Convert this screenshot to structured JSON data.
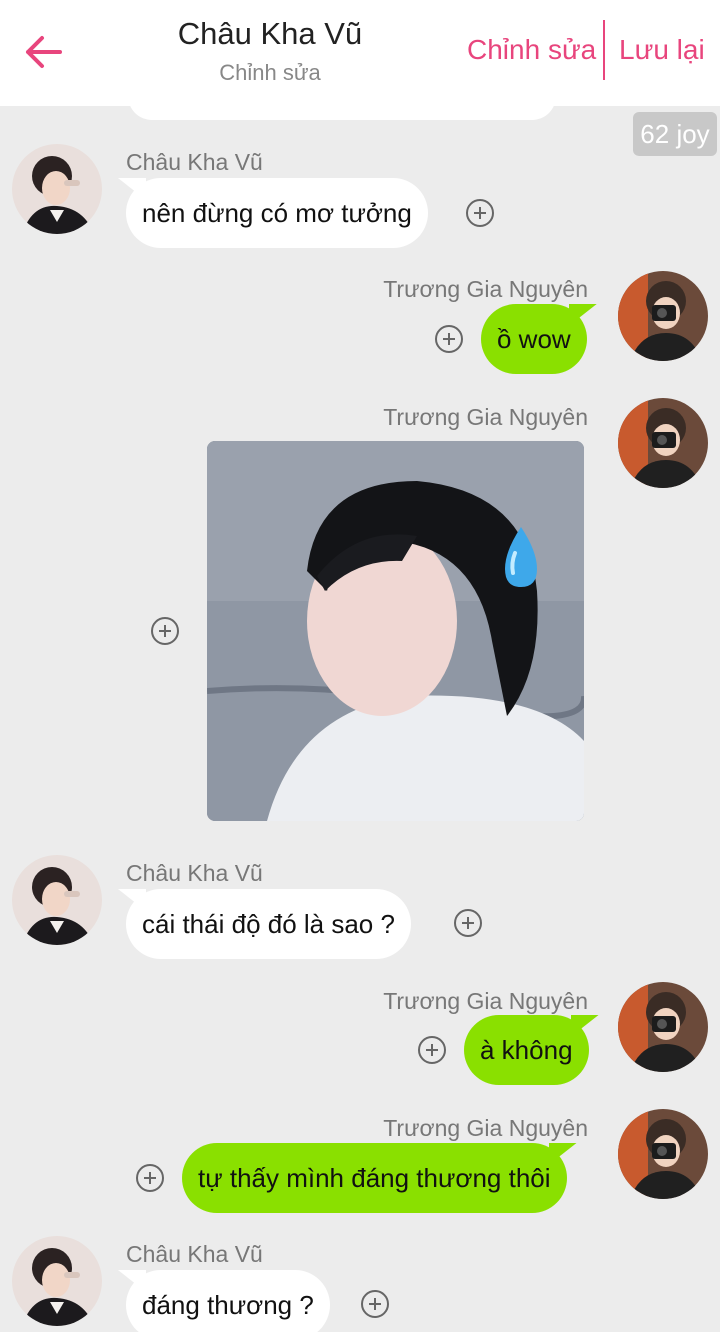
{
  "header": {
    "title": "Châu Kha Vũ",
    "subtitle": "Chỉnh sửa",
    "edit_label": "Chỉnh sửa",
    "save_label": "Lưu lại",
    "accent_color": "#e8457d"
  },
  "joy_badge": "62 joy",
  "participants": {
    "left": "Châu Kha Vũ",
    "right": "Trương Gia Nguyên"
  },
  "messages": [
    {
      "side": "left",
      "sender": "Châu Kha Vũ",
      "text": "nên đừng có mơ tưởng"
    },
    {
      "side": "right",
      "sender": "Trương Gia Nguyên",
      "text": "ồ wow"
    },
    {
      "side": "right",
      "sender": "Trương Gia Nguyên",
      "type": "image",
      "image": "sweat-drop-reaction-photo"
    },
    {
      "side": "left",
      "sender": "Châu Kha Vũ",
      "text": "cái thái độ đó là sao ?"
    },
    {
      "side": "right",
      "sender": "Trương Gia Nguyên",
      "text": "à không"
    },
    {
      "side": "right",
      "sender": "Trương Gia Nguyên",
      "text": "tự thấy mình đáng thương thôi"
    },
    {
      "side": "left",
      "sender": "Châu Kha Vũ",
      "text": "đáng thương ?"
    }
  ],
  "colors": {
    "background": "#ececec",
    "left_bubble": "#ffffff",
    "right_bubble": "#8ae000"
  }
}
